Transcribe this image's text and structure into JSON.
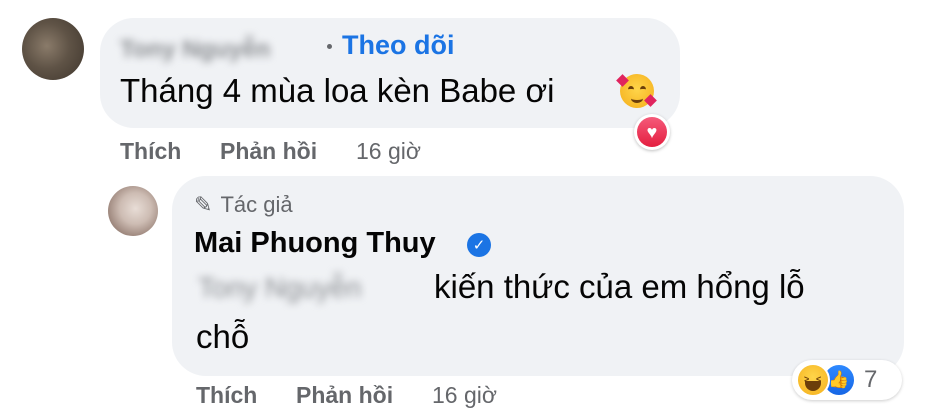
{
  "comment1": {
    "author": "Tony Nguyễn",
    "follow_label": "Theo dõi",
    "text": "Tháng 4 mùa loa kèn Babe ơi",
    "emoji": "smiling-face-with-hearts",
    "reaction_badge": "heart",
    "actions": {
      "like": "Thích",
      "reply": "Phản hồi",
      "time": "16 giờ"
    }
  },
  "comment2": {
    "author_badge": "Tác giả",
    "author": "Mai Phuong Thuy",
    "verified": true,
    "mention": "Tony Nguyễn",
    "text_line1": "kiến thức của em hổng lỗ",
    "text_line2": "chỗ",
    "reactions": {
      "types": [
        "haha",
        "like"
      ],
      "count": "7"
    },
    "actions": {
      "like": "Thích",
      "reply": "Phản hồi",
      "time": "16 giờ"
    }
  },
  "colors": {
    "link": "#1b74e4",
    "bubble": "#f0f2f5",
    "muted": "#65676b",
    "text": "#050505"
  }
}
